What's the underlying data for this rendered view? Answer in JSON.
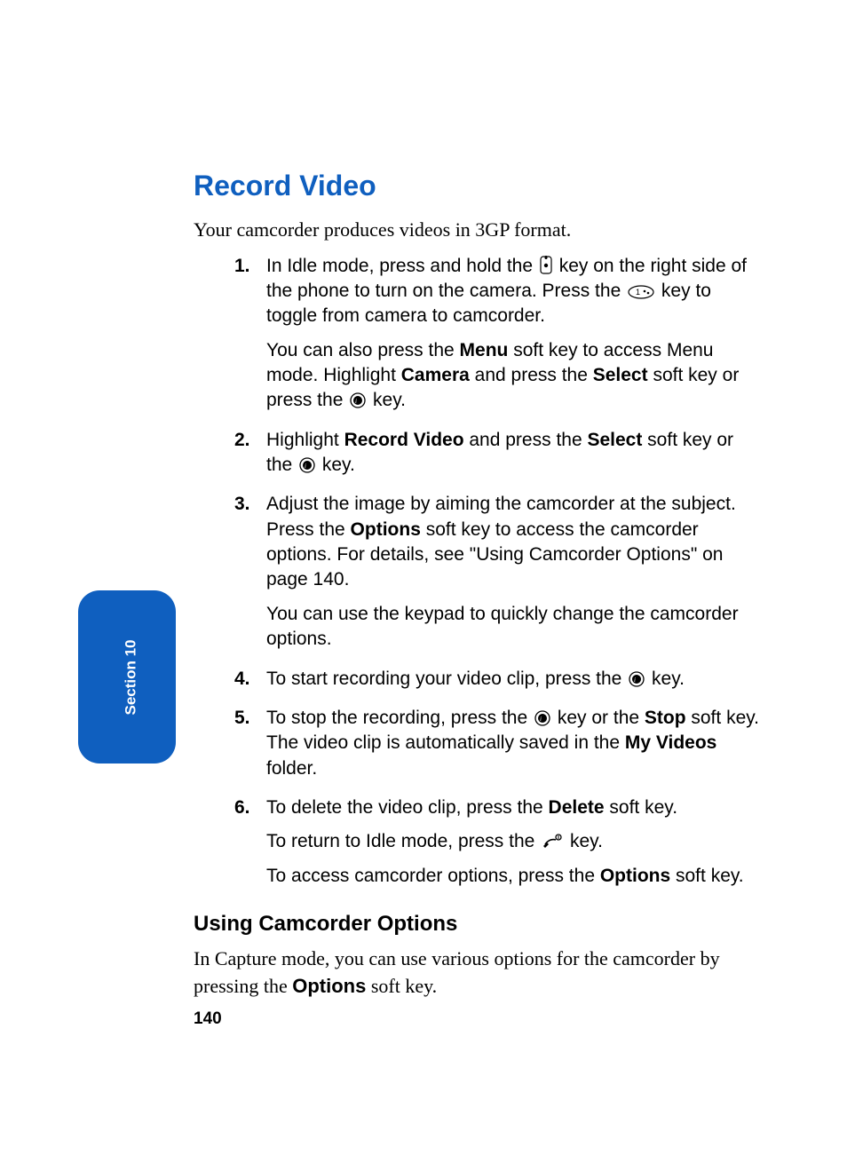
{
  "section_tab": "Section 10",
  "page_number": "140",
  "heading": "Record Video",
  "intro": "Your camcorder produces videos in 3GP format.",
  "steps": {
    "n1": "1.",
    "s1a_1": "In Idle mode, press and hold the ",
    "s1a_2": " key on the right side of the phone to turn on the camera. Press the ",
    "s1a_3": " key to toggle from camera to camcorder.",
    "s1b_1": "You can also press the ",
    "s1b_menu": "Menu",
    "s1b_2": " soft key to access Menu mode. Highlight ",
    "s1b_camera": "Camera",
    "s1b_3": " and press the ",
    "s1b_select": "Select",
    "s1b_4": " soft key or press the ",
    "s1b_5": " key.",
    "n2": "2.",
    "s2_1": "Highlight ",
    "s2_rv": "Record Video",
    "s2_2": " and press the ",
    "s2_select": "Select",
    "s2_3": " soft key or the ",
    "s2_4": " key.",
    "n3": "3.",
    "s3a_1": "Adjust the image by aiming the camcorder at the subject. Press the ",
    "s3a_options": "Options",
    "s3a_2": " soft key to access the camcorder options. For details, see \"Using Camcorder Options\" on page 140.",
    "s3b": "You can use the keypad to quickly change the camcorder options.",
    "n4": "4.",
    "s4_1": "To start recording your video clip, press the ",
    "s4_2": " key.",
    "n5": "5.",
    "s5_1": "To stop the recording, press the ",
    "s5_2": " key or the ",
    "s5_stop": "Stop",
    "s5_3": " soft key. The video clip is automatically saved in the ",
    "s5_mv": "My Videos",
    "s5_4": " folder.",
    "n6": "6.",
    "s6a_1": "To delete the video clip, press the ",
    "s6a_delete": "Delete",
    "s6a_2": " soft key.",
    "s6b_1": "To return to Idle mode, press the ",
    "s6b_2": " key.",
    "s6c_1": "To access camcorder options, press the ",
    "s6c_options": "Options",
    "s6c_2": " soft key."
  },
  "subheading": "Using Camcorder Options",
  "sub_body_1": "In Capture mode, you can use various options for the camcorder by pressing the ",
  "sub_body_options": "Options",
  "sub_body_2": " soft key."
}
